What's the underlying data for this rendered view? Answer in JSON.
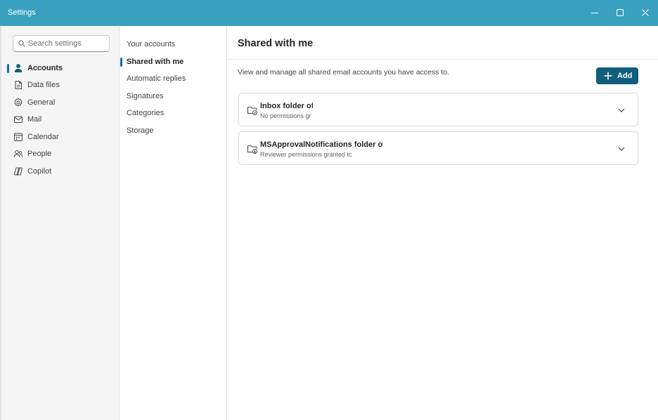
{
  "window": {
    "title": "Settings"
  },
  "colors": {
    "titlebar": "#3aa0bf",
    "accent": "#0f6cbd",
    "add_button": "#115e7c"
  },
  "search": {
    "placeholder": "Search settings",
    "value": ""
  },
  "nav": {
    "items": [
      {
        "label": "Accounts",
        "icon": "person-icon",
        "active": true
      },
      {
        "label": "Data files",
        "icon": "document-icon"
      },
      {
        "label": "General",
        "icon": "gear-icon"
      },
      {
        "label": "Mail",
        "icon": "mail-icon"
      },
      {
        "label": "Calendar",
        "icon": "calendar-icon"
      },
      {
        "label": "People",
        "icon": "people-icon"
      },
      {
        "label": "Copilot",
        "icon": "copilot-icon"
      }
    ]
  },
  "subnav": {
    "items": [
      {
        "label": "Your accounts"
      },
      {
        "label": "Shared with me",
        "active": true
      },
      {
        "label": "Automatic replies"
      },
      {
        "label": "Signatures"
      },
      {
        "label": "Categories"
      },
      {
        "label": "Storage"
      }
    ]
  },
  "main": {
    "title": "Shared with me",
    "description": "View and manage all shared email accounts you have access to.",
    "add_label": "Add",
    "cards": [
      {
        "title": "Inbox folder of",
        "subtitle": "No permissions gr",
        "icon": "folder-shared-icon"
      },
      {
        "title": "MSApprovalNotifications folder of ·",
        "subtitle": "Reviewer permissions granted tc",
        "icon": "folder-shared-icon"
      }
    ]
  }
}
